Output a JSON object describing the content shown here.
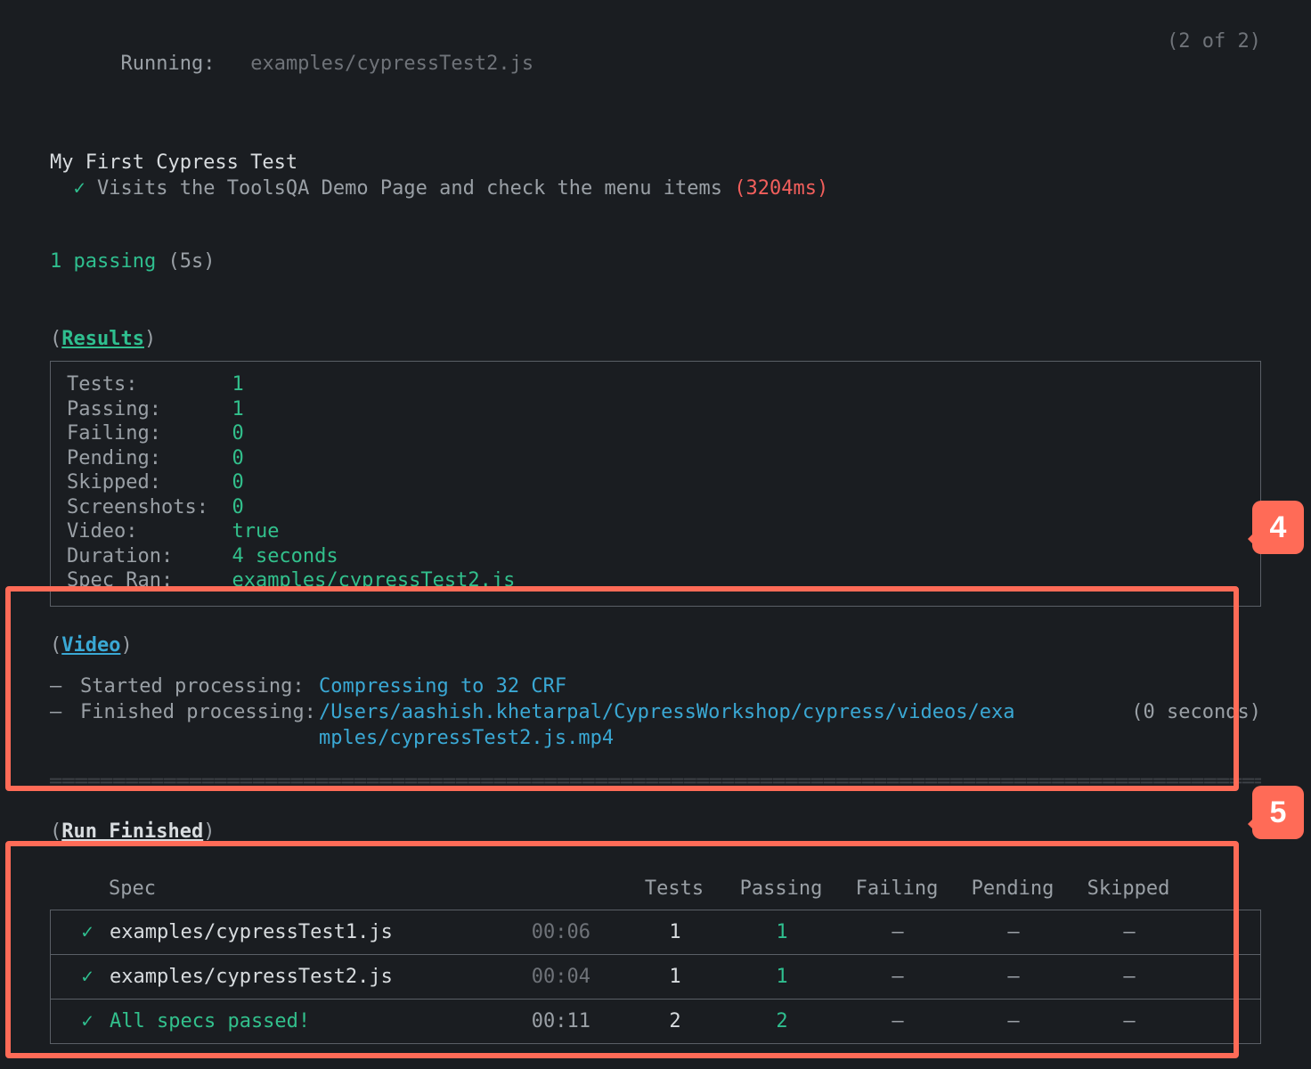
{
  "running": {
    "label": "Running:",
    "spec": "examples/cypressTest2.js",
    "counter": "(2 of 2)"
  },
  "suite": {
    "title": "My First Cypress Test",
    "checkmark": "✓",
    "testTitle": "Visits the ToolsQA Demo Page and check the menu items",
    "duration": "(3204ms)"
  },
  "summary": {
    "passingCount": "1 passing",
    "passingTime": "(5s)"
  },
  "sections": {
    "results": "Results",
    "video": "Video",
    "runFinished": "Run Finished"
  },
  "results": {
    "Tests": "1",
    "Passing": "1",
    "Failing": "0",
    "Pending": "0",
    "Skipped": "0",
    "Screenshots": "0",
    "Video": "true",
    "Duration": "4 seconds",
    "SpecRan": "examples/cypressTest2.js",
    "labels": {
      "Tests": "Tests:",
      "Passing": "Passing:",
      "Failing": "Failing:",
      "Pending": "Pending:",
      "Skipped": "Skipped:",
      "Screenshots": "Screenshots:",
      "Video": "Video:",
      "Duration": "Duration:",
      "SpecRan": "Spec Ran:"
    }
  },
  "video": {
    "startedLabel": "Started processing:",
    "startedValue": "Compressing to 32 CRF",
    "finishedLabel": "Finished processing:",
    "finishedValueLine1": "/Users/aashish.khetarpal/CypressWorkshop/cypress/videos/exa",
    "finishedValueLine2": "mples/cypressTest2.js.mp4",
    "finishedTime": "(0 seconds)",
    "dash": "–"
  },
  "table": {
    "headers": {
      "spec": "Spec",
      "tests": "Tests",
      "passing": "Passing",
      "failing": "Failing",
      "pending": "Pending",
      "skipped": "Skipped"
    },
    "rows": [
      {
        "check": "✓",
        "spec": "examples/cypressTest1.js",
        "time": "00:06",
        "tests": "1",
        "passing": "1",
        "failing": "–",
        "pending": "–",
        "skipped": "–"
      },
      {
        "check": "✓",
        "spec": "examples/cypressTest2.js",
        "time": "00:04",
        "tests": "1",
        "passing": "1",
        "failing": "–",
        "pending": "–",
        "skipped": "–"
      }
    ],
    "total": {
      "check": "✓",
      "label": "All specs passed!",
      "time": "00:11",
      "tests": "2",
      "passing": "2",
      "failing": "–",
      "pending": "–",
      "skipped": "–"
    }
  },
  "callouts": {
    "n4": "4",
    "n5": "5"
  }
}
